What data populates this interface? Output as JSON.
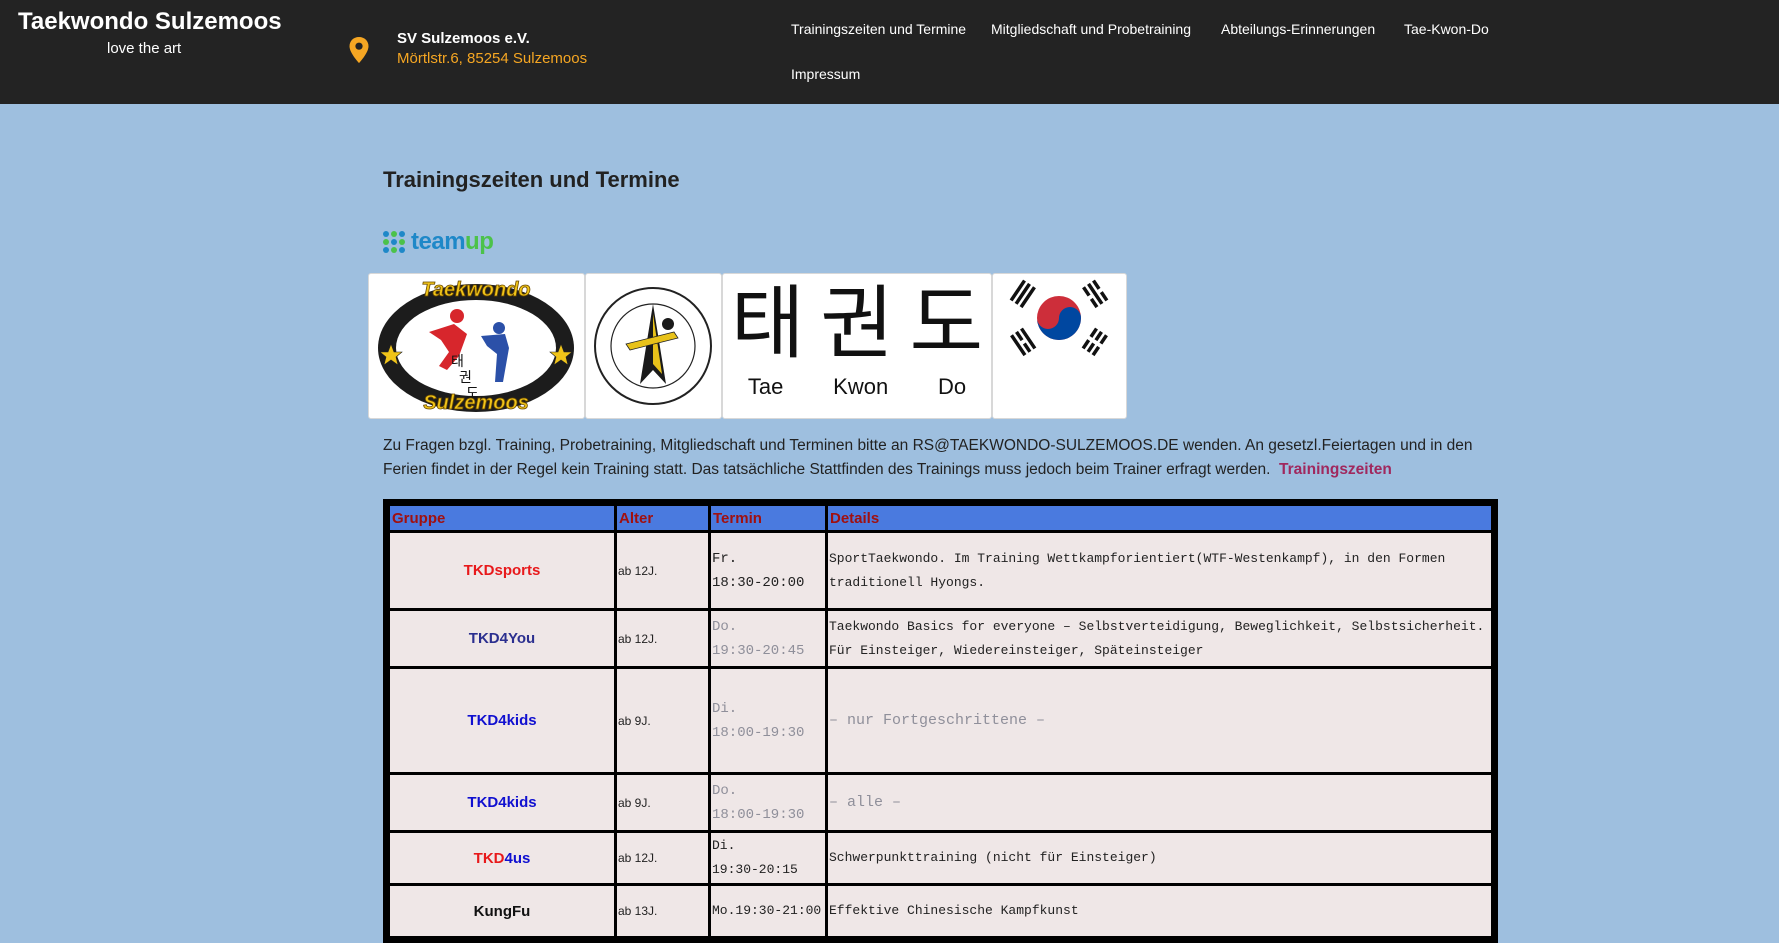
{
  "header": {
    "site_title": "Taekwondo Sulzemoos",
    "tagline": "love the art",
    "org_name": "SV Sulzemoos e.V.",
    "org_address": "Mörtlstr.6, 85254 Sulzemoos",
    "nav": [
      "Trainingszeiten und Termine",
      "Mitgliedschaft und Probetraining",
      "Abteilungs-Erinnerungen",
      "Tae-Kwon-Do",
      "Impressum"
    ]
  },
  "main": {
    "page_title": "Trainingszeiten und Termine",
    "teamup": {
      "part1": "team",
      "part2": "up"
    },
    "logos": {
      "club_arc_top": "Taekwondo",
      "club_arc_bottom": "Sulzemoos",
      "hangul": [
        "태",
        "권",
        "도"
      ],
      "roman": [
        "Tae",
        "Kwon",
        "Do"
      ]
    },
    "intro_text": "Zu Fragen bzgl. Training, Probetraining, Mitgliedschaft und Terminen bitte an RS@TAEKWONDO-SULZEMOOS.DE wenden. An gesetzl.Feiertagen und in den Ferien findet in der Regel kein Training statt. Das tatsächliche Stattfinden des Trainings muss jedoch beim Trainer erfragt werden.",
    "intro_link": "Trainingszeiten",
    "table": {
      "headers": [
        "Gruppe",
        "Alter",
        "Termin",
        "Details"
      ],
      "rows": [
        {
          "group": "TKDsports",
          "age": "ab 12J.",
          "day": "Fr.",
          "time": "18:30-20:00",
          "details": "SportTaekwondo. Im Training Wettkampforientiert(WTF-Westenkampf), in den Formen traditionell Hyongs."
        },
        {
          "group": "TKD4You",
          "age": "ab 12J.",
          "day": "Do.",
          "time": "19:30-20:45",
          "details": "Taekwondo Basics for everyone – Selbstverteidigung, Beweglichkeit, Selbstsicherheit. Für Einsteiger, Wiedereinsteiger, Späteinsteiger"
        },
        {
          "group": "TKD4kids",
          "age": "ab 9J.",
          "day": "Di.",
          "time": "18:00-19:30",
          "details": "– nur Fortgeschrittene –"
        },
        {
          "group": "TKD4kids",
          "age": "ab 9J.",
          "day": "Do.",
          "time": "18:00-19:30",
          "details": "– alle –"
        },
        {
          "group_a": "TKD",
          "group_b": "4us",
          "age": "ab 12J.",
          "day": "Di.",
          "time": "19:30-20:15",
          "details": "Schwerpunkttraining (nicht für Einsteiger)"
        },
        {
          "group": "KungFu",
          "age": "ab 13J.",
          "day": "Mo.",
          "time": "19:30-21:00",
          "details": "Effektive Chinesische Kampfkunst"
        }
      ]
    },
    "colors": {
      "header_bg": "#232323",
      "page_bg": "#9ebfdf",
      "address": "#f5a623",
      "link": "#a0285e",
      "table_header_bg": "#4a7adf",
      "table_header_text": "#a01010",
      "group_red": "#e8191b",
      "group_navy": "#2b2f8f",
      "group_blue": "#1010d0"
    }
  }
}
